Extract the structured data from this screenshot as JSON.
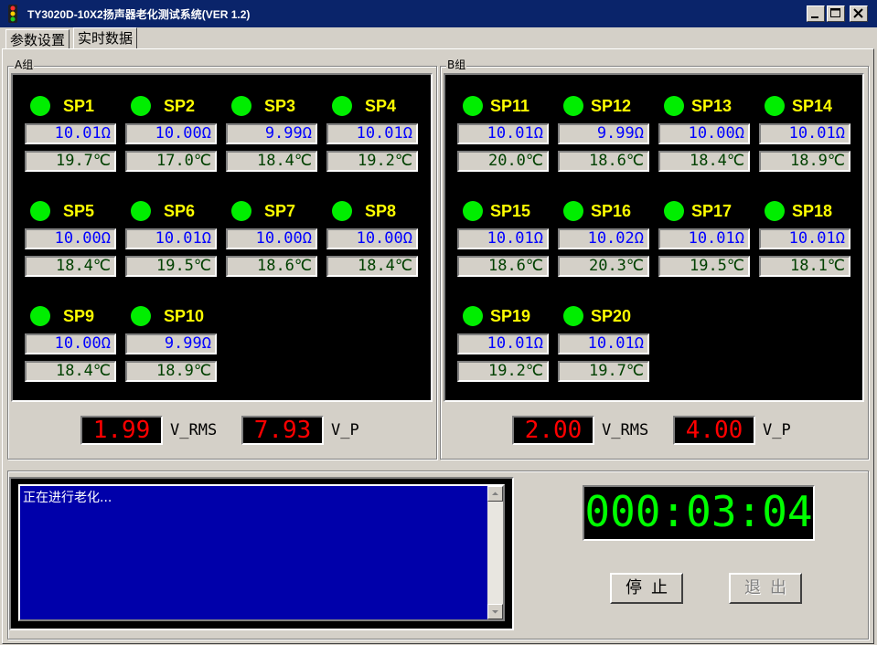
{
  "window": {
    "title": "TY3020D-10X2扬声器老化测试系统(VER 1.2)",
    "controls": {
      "minimize": "_",
      "maximize": "□",
      "close": "×"
    }
  },
  "tabs": [
    {
      "label": "参数设置",
      "active": false
    },
    {
      "label": "实时数据",
      "active": true
    }
  ],
  "groupA": {
    "label": "A组",
    "speakers": [
      {
        "name": "SP1",
        "resistance": "10.01Ω",
        "temperature": "19.7℃"
      },
      {
        "name": "SP2",
        "resistance": "10.00Ω",
        "temperature": "17.0℃"
      },
      {
        "name": "SP3",
        "resistance": "9.99Ω",
        "temperature": "18.4℃"
      },
      {
        "name": "SP4",
        "resistance": "10.01Ω",
        "temperature": "19.2℃"
      },
      {
        "name": "SP5",
        "resistance": "10.00Ω",
        "temperature": "18.4℃"
      },
      {
        "name": "SP6",
        "resistance": "10.01Ω",
        "temperature": "19.5℃"
      },
      {
        "name": "SP7",
        "resistance": "10.00Ω",
        "temperature": "18.6℃"
      },
      {
        "name": "SP8",
        "resistance": "10.00Ω",
        "temperature": "18.4℃"
      },
      {
        "name": "SP9",
        "resistance": "10.00Ω",
        "temperature": "18.4℃"
      },
      {
        "name": "SP10",
        "resistance": "9.99Ω",
        "temperature": "18.9℃"
      }
    ],
    "vrms": "1.99",
    "vrms_label": "V_RMS",
    "vp": "7.93",
    "vp_label": "V_P"
  },
  "groupB": {
    "label": "B组",
    "speakers": [
      {
        "name": "SP11",
        "resistance": "10.01Ω",
        "temperature": "20.0℃"
      },
      {
        "name": "SP12",
        "resistance": "9.99Ω",
        "temperature": "18.6℃"
      },
      {
        "name": "SP13",
        "resistance": "10.00Ω",
        "temperature": "18.4℃"
      },
      {
        "name": "SP14",
        "resistance": "10.01Ω",
        "temperature": "18.9℃"
      },
      {
        "name": "SP15",
        "resistance": "10.01Ω",
        "temperature": "18.6℃"
      },
      {
        "name": "SP16",
        "resistance": "10.02Ω",
        "temperature": "20.3℃"
      },
      {
        "name": "SP17",
        "resistance": "10.01Ω",
        "temperature": "19.5℃"
      },
      {
        "name": "SP18",
        "resistance": "10.01Ω",
        "temperature": "18.1℃"
      },
      {
        "name": "SP19",
        "resistance": "10.01Ω",
        "temperature": "19.2℃"
      },
      {
        "name": "SP20",
        "resistance": "10.01Ω",
        "temperature": "19.7℃"
      }
    ],
    "vrms": "2.00",
    "vrms_label": "V_RMS",
    "vp": "4.00",
    "vp_label": "V_P"
  },
  "log": {
    "text": "正在进行老化..."
  },
  "timer": {
    "value": "000:03:04"
  },
  "buttons": {
    "stop": "停止",
    "exit": "退出",
    "exit_enabled": false
  },
  "colors": {
    "led_on": "#00ee00",
    "label": "#ffff00",
    "resistance_text": "#0000ff",
    "temperature_text": "#004000",
    "meter_text": "#ff0000",
    "timer_text": "#00ff00",
    "log_background": "#0000aa",
    "titlebar": "#0a246a"
  }
}
